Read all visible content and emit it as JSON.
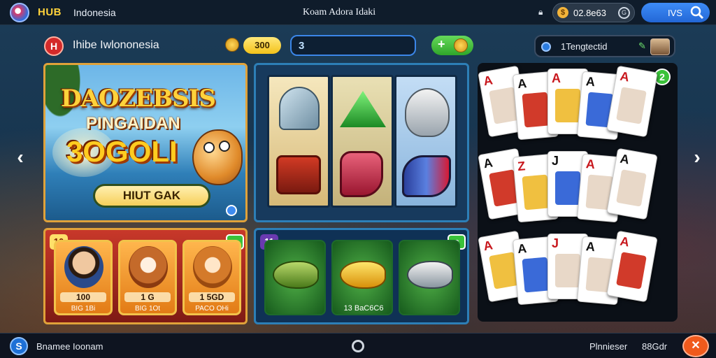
{
  "topbar": {
    "brand": "HUB",
    "brand_sub": "Indonesia",
    "title": "Koam Adora Idaki",
    "lock_icon": "lock-icon",
    "balance": "02.8e63",
    "search_label": "IVS"
  },
  "header": {
    "site_icon": "H",
    "site_name": "Ihibe Iwlononesia",
    "coins": "300",
    "input_value": "3",
    "add_label": "+",
    "username": "1Tengtectid"
  },
  "promo": {
    "title1": "DAOZEBSIS",
    "title2": "PINGAIDAN",
    "title3": "3OGOLI",
    "button": "HIUT GAK"
  },
  "slots_panel": {
    "tag": "10",
    "badge": "2",
    "items": [
      {
        "amount": "100",
        "label": "BIG 1Bi"
      },
      {
        "amount": "1 G",
        "label": "BIG 1Ot"
      },
      {
        "amount": "1 5GD",
        "label": "PACO OHi"
      }
    ]
  },
  "fish_panel": {
    "tag": "11",
    "badge": "3",
    "items": [
      {
        "label": ""
      },
      {
        "label": "13 BaC6C6"
      },
      {
        "label": ""
      }
    ]
  },
  "cards": {
    "badge": "2",
    "row1": [
      "A",
      "A",
      "A",
      "A",
      "A"
    ],
    "row2": [
      "A",
      "Z",
      "J",
      "A",
      "A"
    ],
    "row3": [
      "A",
      "A",
      "J",
      "A",
      "A"
    ]
  },
  "bottombar": {
    "left_text": "Bnamee Ioonam",
    "right_text1": "Plnnieser",
    "right_text2": "88Gdr"
  },
  "colors": {
    "accent_blue": "#2d7fb7",
    "gold": "#e0a23a",
    "green": "#3ac23a"
  }
}
